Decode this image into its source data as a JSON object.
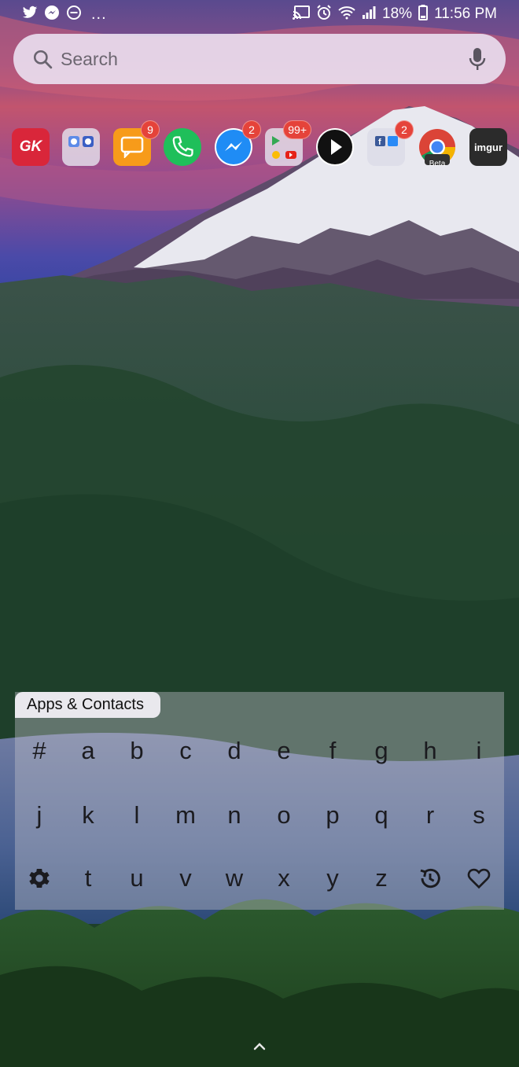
{
  "status_bar": {
    "left_icons": [
      "twitter-icon",
      "messenger-icon",
      "do-not-disturb-icon"
    ],
    "more_indicator": "...",
    "right_icons": [
      "cast-icon",
      "alarm-icon",
      "wifi-icon",
      "signal-icon"
    ],
    "battery_percent": "18%",
    "time": "11:56 PM"
  },
  "search": {
    "placeholder": "Search",
    "icon": "search-icon",
    "mic_icon": "mic-icon"
  },
  "apps": [
    {
      "name": "GK",
      "label": "GK",
      "badge": null
    },
    {
      "name": "camera-folder",
      "label": "",
      "badge": null
    },
    {
      "name": "messages",
      "label": "",
      "badge": "9"
    },
    {
      "name": "phone",
      "label": "",
      "badge": null
    },
    {
      "name": "messenger",
      "label": "",
      "badge": "2"
    },
    {
      "name": "google-folder",
      "label": "",
      "badge": "99+"
    },
    {
      "name": "play",
      "label": "",
      "badge": null
    },
    {
      "name": "facebook-folder",
      "label": "",
      "badge": "2"
    },
    {
      "name": "chrome-beta",
      "label": "Beta",
      "badge": null
    },
    {
      "name": "imgur",
      "label": "imgur",
      "badge": null
    }
  ],
  "keyboard": {
    "tab_label": "Apps & Contacts",
    "rows": [
      [
        "#",
        "a",
        "b",
        "c",
        "d",
        "e",
        "f",
        "g",
        "h",
        "i"
      ],
      [
        "j",
        "k",
        "l",
        "m",
        "n",
        "o",
        "p",
        "q",
        "r",
        "s"
      ],
      [
        "settings-icon",
        "t",
        "u",
        "v",
        "w",
        "x",
        "y",
        "z",
        "history-icon",
        "heart-icon"
      ]
    ]
  },
  "colors": {
    "badge": "#e5433a",
    "search_bg": "#ece4f4",
    "gk_red": "#d9263a",
    "phone_green": "#1fbf5a",
    "messages_orange": "#f79b1a"
  }
}
